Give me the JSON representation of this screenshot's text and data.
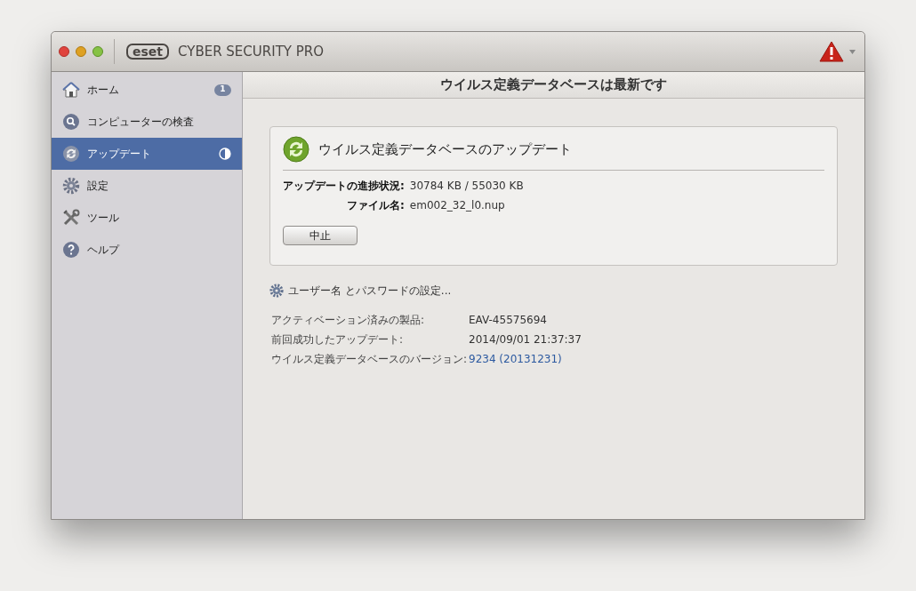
{
  "window": {
    "logo": "eset",
    "title": "CYBER SECURITY PRO",
    "alert": true
  },
  "sidebar": {
    "items": [
      {
        "kind": "home",
        "label": "ホーム",
        "selected": false,
        "badge": "1"
      },
      {
        "kind": "scan",
        "label": "コンピューターの検査",
        "selected": false
      },
      {
        "kind": "update",
        "label": "アップデート",
        "selected": true,
        "in_progress": true
      },
      {
        "kind": "settings",
        "label": "設定",
        "selected": false
      },
      {
        "kind": "tools",
        "label": "ツール",
        "selected": false
      },
      {
        "kind": "help",
        "label": "ヘルプ",
        "selected": false
      }
    ]
  },
  "header": "ウイルス定義データベースは最新です",
  "update_panel": {
    "title": "ウイルス定義データベースのアップデート",
    "fields": [
      {
        "label": "アップデートの進捗状況:",
        "value": "30784 KB / 55030 KB"
      },
      {
        "label": "ファイル名:",
        "value": "em002_32_l0.nup"
      }
    ],
    "button": "中止"
  },
  "settings_link": "ユーザー名 とパスワードの設定...",
  "info": [
    {
      "label": "アクティベーション済みの製品:",
      "value": "EAV-45575694",
      "link": false
    },
    {
      "label": "前回成功したアップデート:",
      "value": "2014/09/01 21:37:37",
      "link": false
    },
    {
      "label": "ウイルス定義データベースのバージョン:",
      "value": "9234 (20131231)",
      "link": true
    }
  ]
}
